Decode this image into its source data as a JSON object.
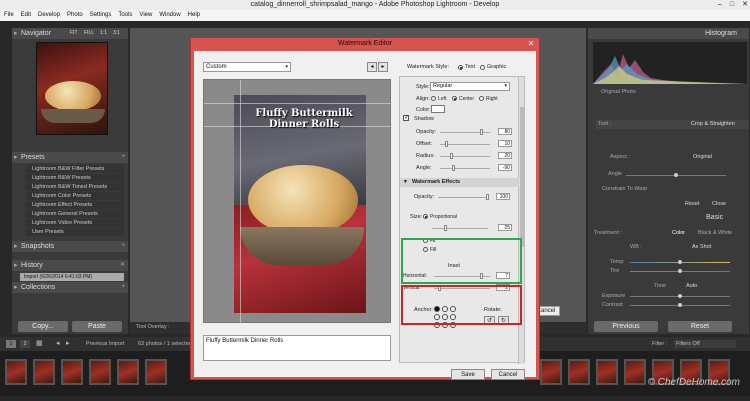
{
  "window": {
    "title": "catalog_dinnerroll_shrimpsalad_mango - Adobe Photoshop Lightroom - Develop"
  },
  "menu": [
    "File",
    "Edit",
    "Develop",
    "Photo",
    "Settings",
    "Tools",
    "View",
    "Window",
    "Help"
  ],
  "left_panel": {
    "navigator": {
      "title": "Navigator",
      "zoom": [
        "FIT",
        "FILL",
        "1:1",
        "3:1"
      ]
    },
    "presets": {
      "title": "Presets",
      "items": [
        "Lightroom B&W Filter Presets",
        "Lightroom B&W Presets",
        "Lightroom B&W Toned Presets",
        "Lightroom Color Presets",
        "Lightroom Effect Presets",
        "Lightroom General Presets",
        "Lightroom Video Presets",
        "User Presets"
      ]
    },
    "snapshots": {
      "title": "Snapshots"
    },
    "history": {
      "title": "History",
      "item": "Import (6/26/2014 6:41:03 PM)"
    },
    "collections": {
      "title": "Collections"
    },
    "copy_label": "Copy...",
    "paste_label": "Paste"
  },
  "right_panel": {
    "histogram": "Histogram",
    "original_photo": "Original Photo",
    "crop": "Crop & Straighten",
    "tool": "Tool :",
    "aspect": "Aspect :",
    "original": "Original",
    "angle": "Angle",
    "constrain": "Constrain To Warp",
    "reset": "Reset",
    "close": "Close",
    "basic": "Basic",
    "treatment": "Treatment :",
    "color": "Color",
    "bw": "Black & White",
    "wb": "WB :",
    "as_shot": "As Shot",
    "temp": "Temp",
    "tint": "Tint",
    "tone": "Tone",
    "auto": "Auto",
    "exposure": "Exposure",
    "contrast": "Contrast",
    "previous": "Previous",
    "reset_btn": "Reset"
  },
  "toolbar": {
    "overlay": "Tool Overlay :"
  },
  "filmbar": {
    "pages": [
      "1",
      "2"
    ],
    "source": "Previous Import",
    "count": "63 photos / 1 selected",
    "filter_label": "Filter :",
    "filter_value": "Filters Off"
  },
  "dialog": {
    "title": "Watermark Editor",
    "preset": "Custom",
    "style_label": "Watermark Style:",
    "style_text": "Text",
    "style_graphic": "Graphic",
    "text_options": {
      "style_label": "Style:",
      "style_value": "Regular",
      "align_label": "Align:",
      "align_left": "Left",
      "align_center": "Center",
      "align_right": "Right",
      "color_label": "Color:"
    },
    "shadow": {
      "title": "Shadow",
      "opacity_label": "Opacity:",
      "opacity": "80",
      "offset_label": "Offset:",
      "offset": "10",
      "radius_label": "Radius:",
      "radius": "20",
      "angle_label": "Angle:",
      "angle": "-90"
    },
    "effects": {
      "title": "Watermark Effects",
      "opacity_label": "Opacity:",
      "opacity": "100",
      "size_label": "Size:",
      "proportional": "Proportional",
      "size": "25",
      "fit": "Fit",
      "fill": "Fill",
      "inset_label": "Inset",
      "horizontal_label": "Horizontal:",
      "horizontal": "7",
      "vertical_label": "Vertical:",
      "vertical": "2",
      "anchor_label": "Anchor:",
      "rotate_label": "Rotate:"
    },
    "watermark_text": "Fluffy Buttermilk Dinner Rolls",
    "textarea": "Fluffy Buttermilk Dinner Rolls",
    "save": "Save",
    "cancel": "Cancel",
    "behind_cancel": "Cancel"
  },
  "credit": "© ChefDeHome.com",
  "colors": {
    "dialog_frame": "#d9534f",
    "green_highlight": "#2aa84a",
    "red_highlight": "#c0282a"
  }
}
